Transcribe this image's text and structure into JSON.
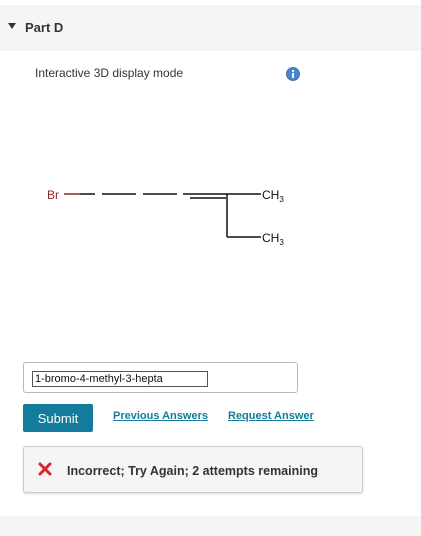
{
  "part": {
    "title": "Part D"
  },
  "display": {
    "mode_label": "Interactive 3D display mode",
    "info_icon": "info-icon"
  },
  "molecule": {
    "atom_br": "Br",
    "ch3_top": "CH",
    "ch3_top_sub": "3",
    "ch3_bottom": "CH",
    "ch3_bottom_sub": "3"
  },
  "answer": {
    "value": "1-bromo-4-methyl-3-hepta"
  },
  "actions": {
    "submit_label": "Submit",
    "previous_answers_label": "Previous Answers",
    "request_answer_label": "Request Answer"
  },
  "feedback": {
    "text": "Incorrect; Try Again; 2 attempts remaining",
    "icon": "x-icon",
    "color": "#d9262c"
  },
  "colors": {
    "accent": "#137c9c",
    "panel": "#f5f5f5"
  }
}
